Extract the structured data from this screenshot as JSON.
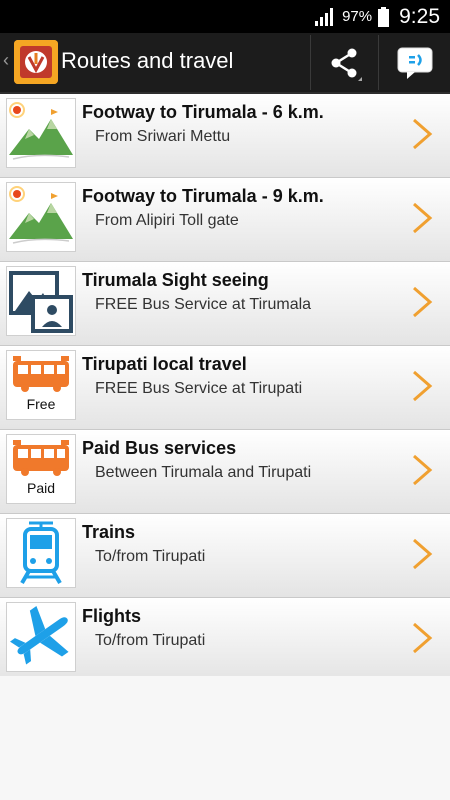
{
  "status": {
    "battery": "97%",
    "time": "9:25"
  },
  "header": {
    "title": "Routes and travel",
    "back_glyph": "‹"
  },
  "items": [
    {
      "title": "Footway to Tirumala - 6 k.m.",
      "subtitle": "From Sriwari Mettu",
      "icon": "mountain-trail-icon"
    },
    {
      "title": "Footway to Tirumala - 9 k.m.",
      "subtitle": "From Alipiri Toll gate",
      "icon": "mountain-trail-icon"
    },
    {
      "title": "Tirumala Sight seeing",
      "subtitle": "FREE Bus Service at Tirumala",
      "icon": "photo-gallery-icon"
    },
    {
      "title": "Tirupati local travel",
      "subtitle": "FREE Bus Service at Tirupati",
      "icon": "bus-icon",
      "badge": "Free"
    },
    {
      "title": "Paid Bus services",
      "subtitle": "Between Tirumala and Tirupati",
      "icon": "bus-icon",
      "badge": "Paid"
    },
    {
      "title": "Trains",
      "subtitle": "To/from Tirupati",
      "icon": "train-icon"
    },
    {
      "title": "Flights",
      "subtitle": "To/from Tirupati",
      "icon": "airplane-icon"
    }
  ],
  "colors": {
    "accent_orange": "#f0792b",
    "chevron": "#f0a030",
    "blue": "#1ea0e8"
  }
}
